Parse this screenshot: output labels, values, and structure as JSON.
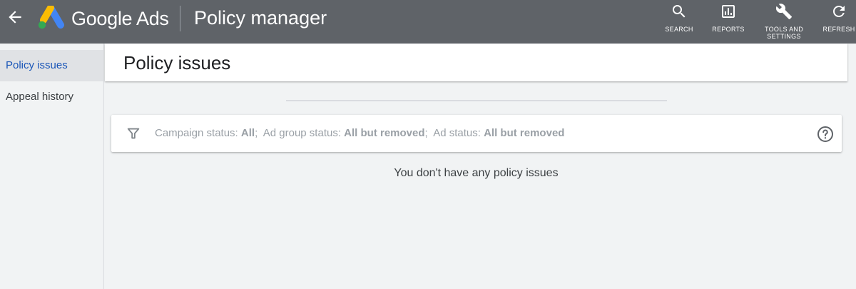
{
  "topbar": {
    "brand_google": "Google",
    "brand_ads": "Ads",
    "page_name": "Policy manager",
    "bg_color": "#5f6368",
    "tools": [
      {
        "label": "SEARCH",
        "icon": "search-icon"
      },
      {
        "label": "REPORTS",
        "icon": "reports-icon"
      },
      {
        "label_line1": "TOOLS AND",
        "label_line2": "SETTINGS",
        "icon": "wrench-icon"
      },
      {
        "label": "REFRESH",
        "icon": "refresh-icon"
      }
    ]
  },
  "sidebar": {
    "items": [
      {
        "label": "Policy issues",
        "active": true
      },
      {
        "label": "Appeal history",
        "active": false
      }
    ],
    "active_color": "#1a56b8"
  },
  "main": {
    "title": "Policy issues",
    "filter": {
      "campaign_label": "Campaign status:",
      "campaign_value": "All",
      "adgroup_label": "Ad group status:",
      "adgroup_value": "All but removed",
      "ad_label": "Ad status:",
      "ad_value": "All but removed",
      "separator": ";"
    },
    "empty_message": "You don't have any policy issues"
  }
}
